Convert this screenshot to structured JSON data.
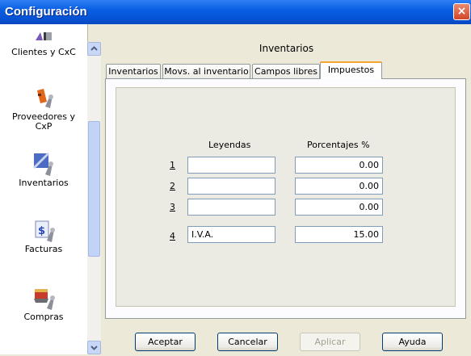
{
  "window": {
    "title": "Configuración",
    "close": "×"
  },
  "sidebar": {
    "items": [
      {
        "label": "Clientes y CxC",
        "icon": "clients-icon"
      },
      {
        "label": "Proveedores y CxP",
        "icon": "suppliers-icon"
      },
      {
        "label": "Inventarios",
        "icon": "inventory-icon",
        "active": true
      },
      {
        "label": "Facturas",
        "icon": "invoices-icon"
      },
      {
        "label": "Compras",
        "icon": "purchases-icon"
      }
    ]
  },
  "section": {
    "title": "Inventarios"
  },
  "tabs": [
    {
      "label": "Inventarios"
    },
    {
      "label": "Movs. al inventario"
    },
    {
      "label": "Campos libres"
    },
    {
      "label": "Impuestos",
      "active": true
    }
  ],
  "taxes": {
    "col_legend": "Leyendas",
    "col_percent": "Porcentajes %",
    "rows": [
      {
        "num": "1",
        "legend": "",
        "percent": "0.00"
      },
      {
        "num": "2",
        "legend": "",
        "percent": "0.00"
      },
      {
        "num": "3",
        "legend": "",
        "percent": "0.00"
      },
      {
        "num": "4",
        "legend": "I.V.A.",
        "percent": "15.00"
      }
    ]
  },
  "buttons": {
    "accept": "Aceptar",
    "cancel": "Cancelar",
    "apply": "Aplicar",
    "help": "Ayuda"
  }
}
